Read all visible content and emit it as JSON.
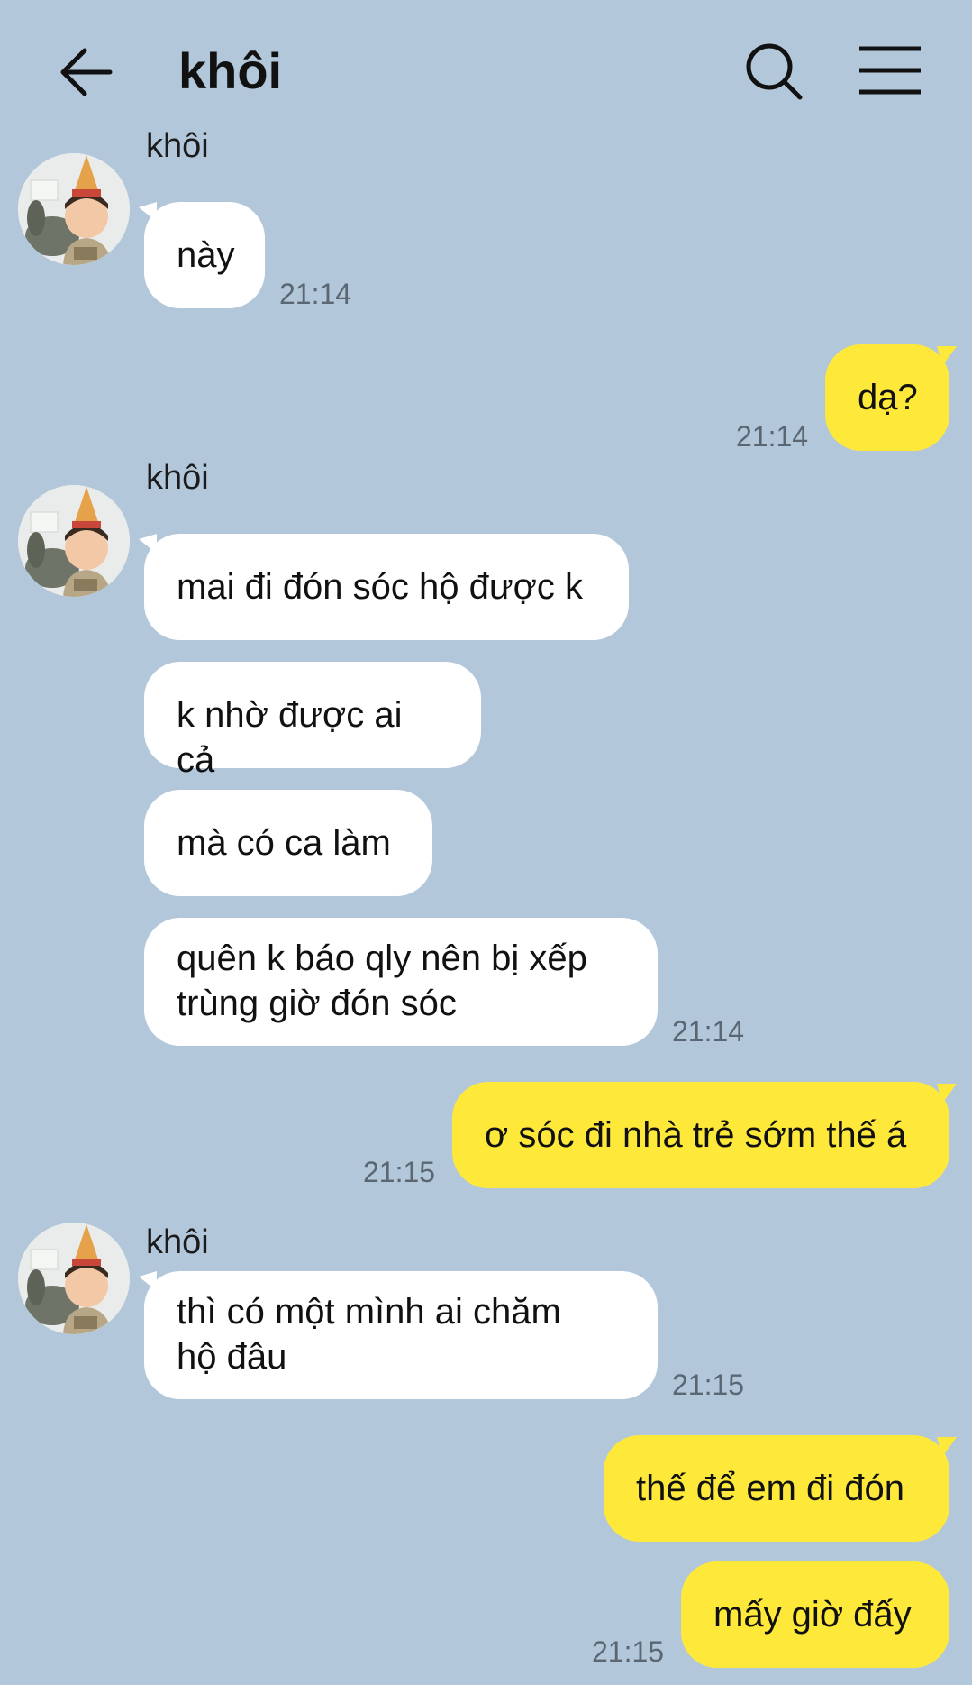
{
  "header": {
    "title": "khôi",
    "back_icon": "arrow-left-icon",
    "search_icon": "search-icon",
    "menu_icon": "hamburger-menu-icon"
  },
  "colors": {
    "background": "#b2c7da",
    "incoming_bubble": "#ffffff",
    "outgoing_bubble": "#fee93a",
    "timestamp": "#5a6672"
  },
  "contact": {
    "name": "khôi",
    "avatar": "child-with-rabbit-photo"
  },
  "messages": [
    {
      "from": "khôi",
      "text": "này",
      "time": "21:14"
    },
    {
      "from": "me",
      "text": "dạ?",
      "time": "21:14"
    },
    {
      "from": "khôi",
      "text": "mai đi đón sóc hộ được k"
    },
    {
      "from": "khôi",
      "text": "k nhờ được ai cả"
    },
    {
      "from": "khôi",
      "text": "mà có ca làm"
    },
    {
      "from": "khôi",
      "text": "quên k báo qly nên bị xếp\ntrùng giờ đón sóc",
      "time": "21:14"
    },
    {
      "from": "me",
      "text": "ơ sóc đi nhà trẻ sớm thế á",
      "time": "21:15"
    },
    {
      "from": "khôi",
      "text": "thì có một mình ai chăm\nhộ đâu",
      "time": "21:15"
    },
    {
      "from": "me",
      "text": "thế để em đi đón"
    },
    {
      "from": "me",
      "text": "mấy giờ đấy",
      "time": "21:15"
    }
  ]
}
